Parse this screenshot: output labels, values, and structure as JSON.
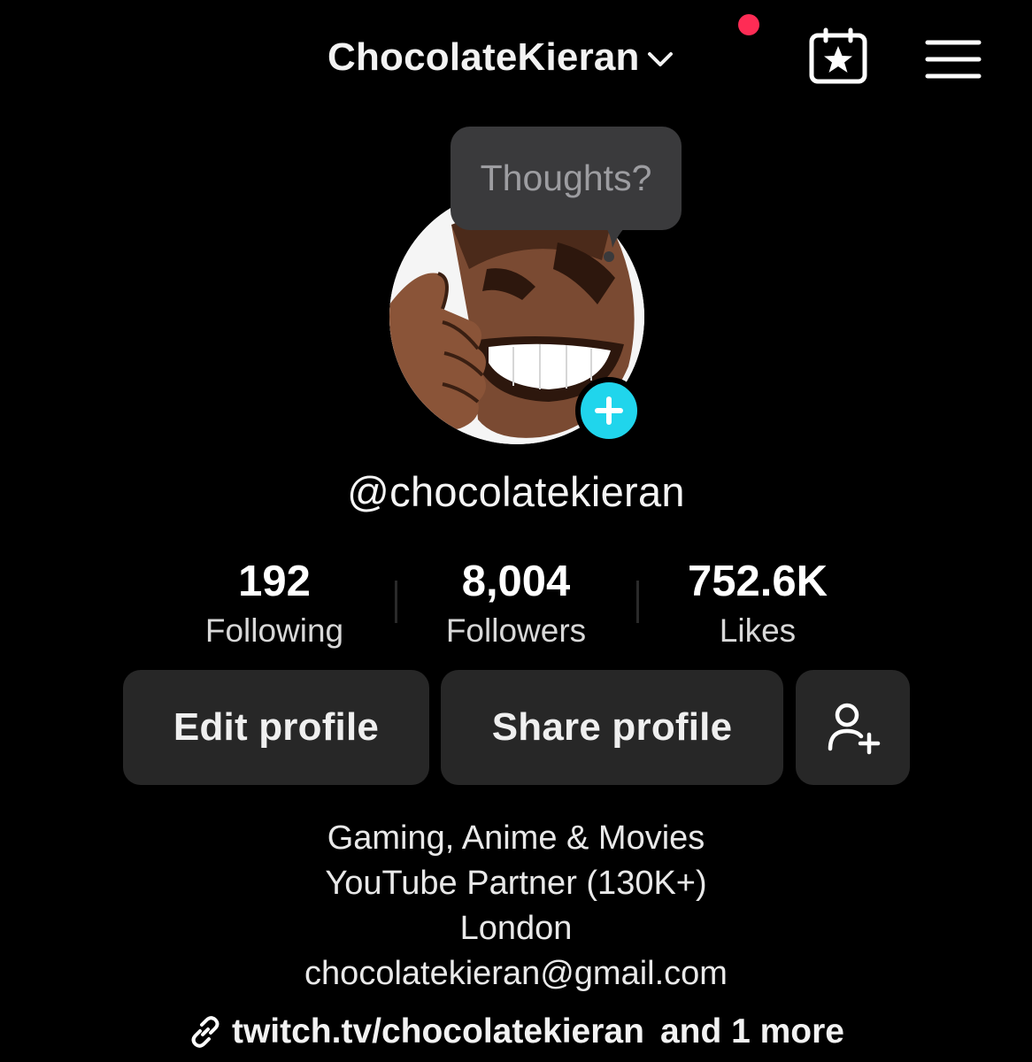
{
  "header": {
    "account_name": "ChocolateKieran",
    "notification_color": "#fe2c55",
    "icons": [
      "chevron-down-icon",
      "calendar-star-icon",
      "hamburger-menu-icon"
    ]
  },
  "thought_bubble": {
    "placeholder": "Thoughts?"
  },
  "profile": {
    "handle": "@chocolatekieran",
    "avatar_badge_color": "#20d5ec"
  },
  "stats": {
    "following": {
      "value": "192",
      "label": "Following"
    },
    "followers": {
      "value": "8,004",
      "label": "Followers"
    },
    "likes": {
      "value": "752.6K",
      "label": "Likes"
    }
  },
  "actions": {
    "edit_label": "Edit profile",
    "share_label": "Share profile",
    "add_friend_icon": "person-add-icon"
  },
  "bio": {
    "lines": [
      "Gaming, Anime & Movies",
      "YouTube Partner (130K+)",
      "London",
      "chocolatekieran@gmail.com"
    ]
  },
  "link": {
    "url": "twitch.tv/chocolatekieran",
    "more": "and 1 more"
  }
}
